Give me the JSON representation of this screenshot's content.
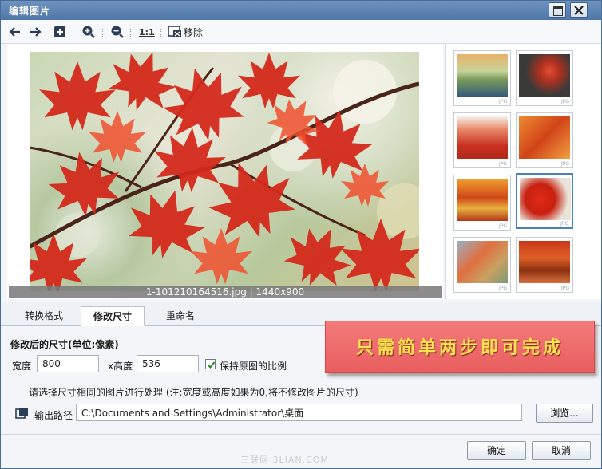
{
  "window": {
    "title": "编辑图片"
  },
  "toolbar": {
    "ratio_label": "1:1",
    "remove_label": "移除"
  },
  "preview": {
    "caption": "1-101210164516.jpg | 1440x900"
  },
  "thumbnails": [
    {
      "ext": "JPG",
      "selected": false
    },
    {
      "ext": "JPG",
      "selected": false
    },
    {
      "ext": "JPG",
      "selected": false
    },
    {
      "ext": "JPG",
      "selected": false
    },
    {
      "ext": "JPG",
      "selected": false
    },
    {
      "ext": "JPG",
      "selected": true
    },
    {
      "ext": "JPG",
      "selected": false
    },
    {
      "ext": "JPG",
      "selected": false
    }
  ],
  "tabs": [
    {
      "label": "转换格式"
    },
    {
      "label": "修改尺寸"
    },
    {
      "label": "重命名"
    }
  ],
  "resize": {
    "section_title": "修改后的尺寸(单位:像素)",
    "width_label": "宽度",
    "width_value": "800",
    "height_label": "x高度",
    "height_value": "536",
    "keep_ratio_label": "保持原图的比例",
    "keep_ratio_checked": true,
    "hint": "请选择尺寸相同的图片进行处理 (注:宽度或高度如果为0,将不修改图片的尺寸)"
  },
  "output": {
    "label": "输出路径",
    "path": "C:\\Documents and Settings\\Administrator\\桌面",
    "browse_label": "浏览..."
  },
  "banner": {
    "text": "只需简单两步即可完成"
  },
  "footer": {
    "ok_label": "确定",
    "cancel_label": "取消"
  },
  "watermark": {
    "text": "三联网 3LIAN.COM"
  }
}
